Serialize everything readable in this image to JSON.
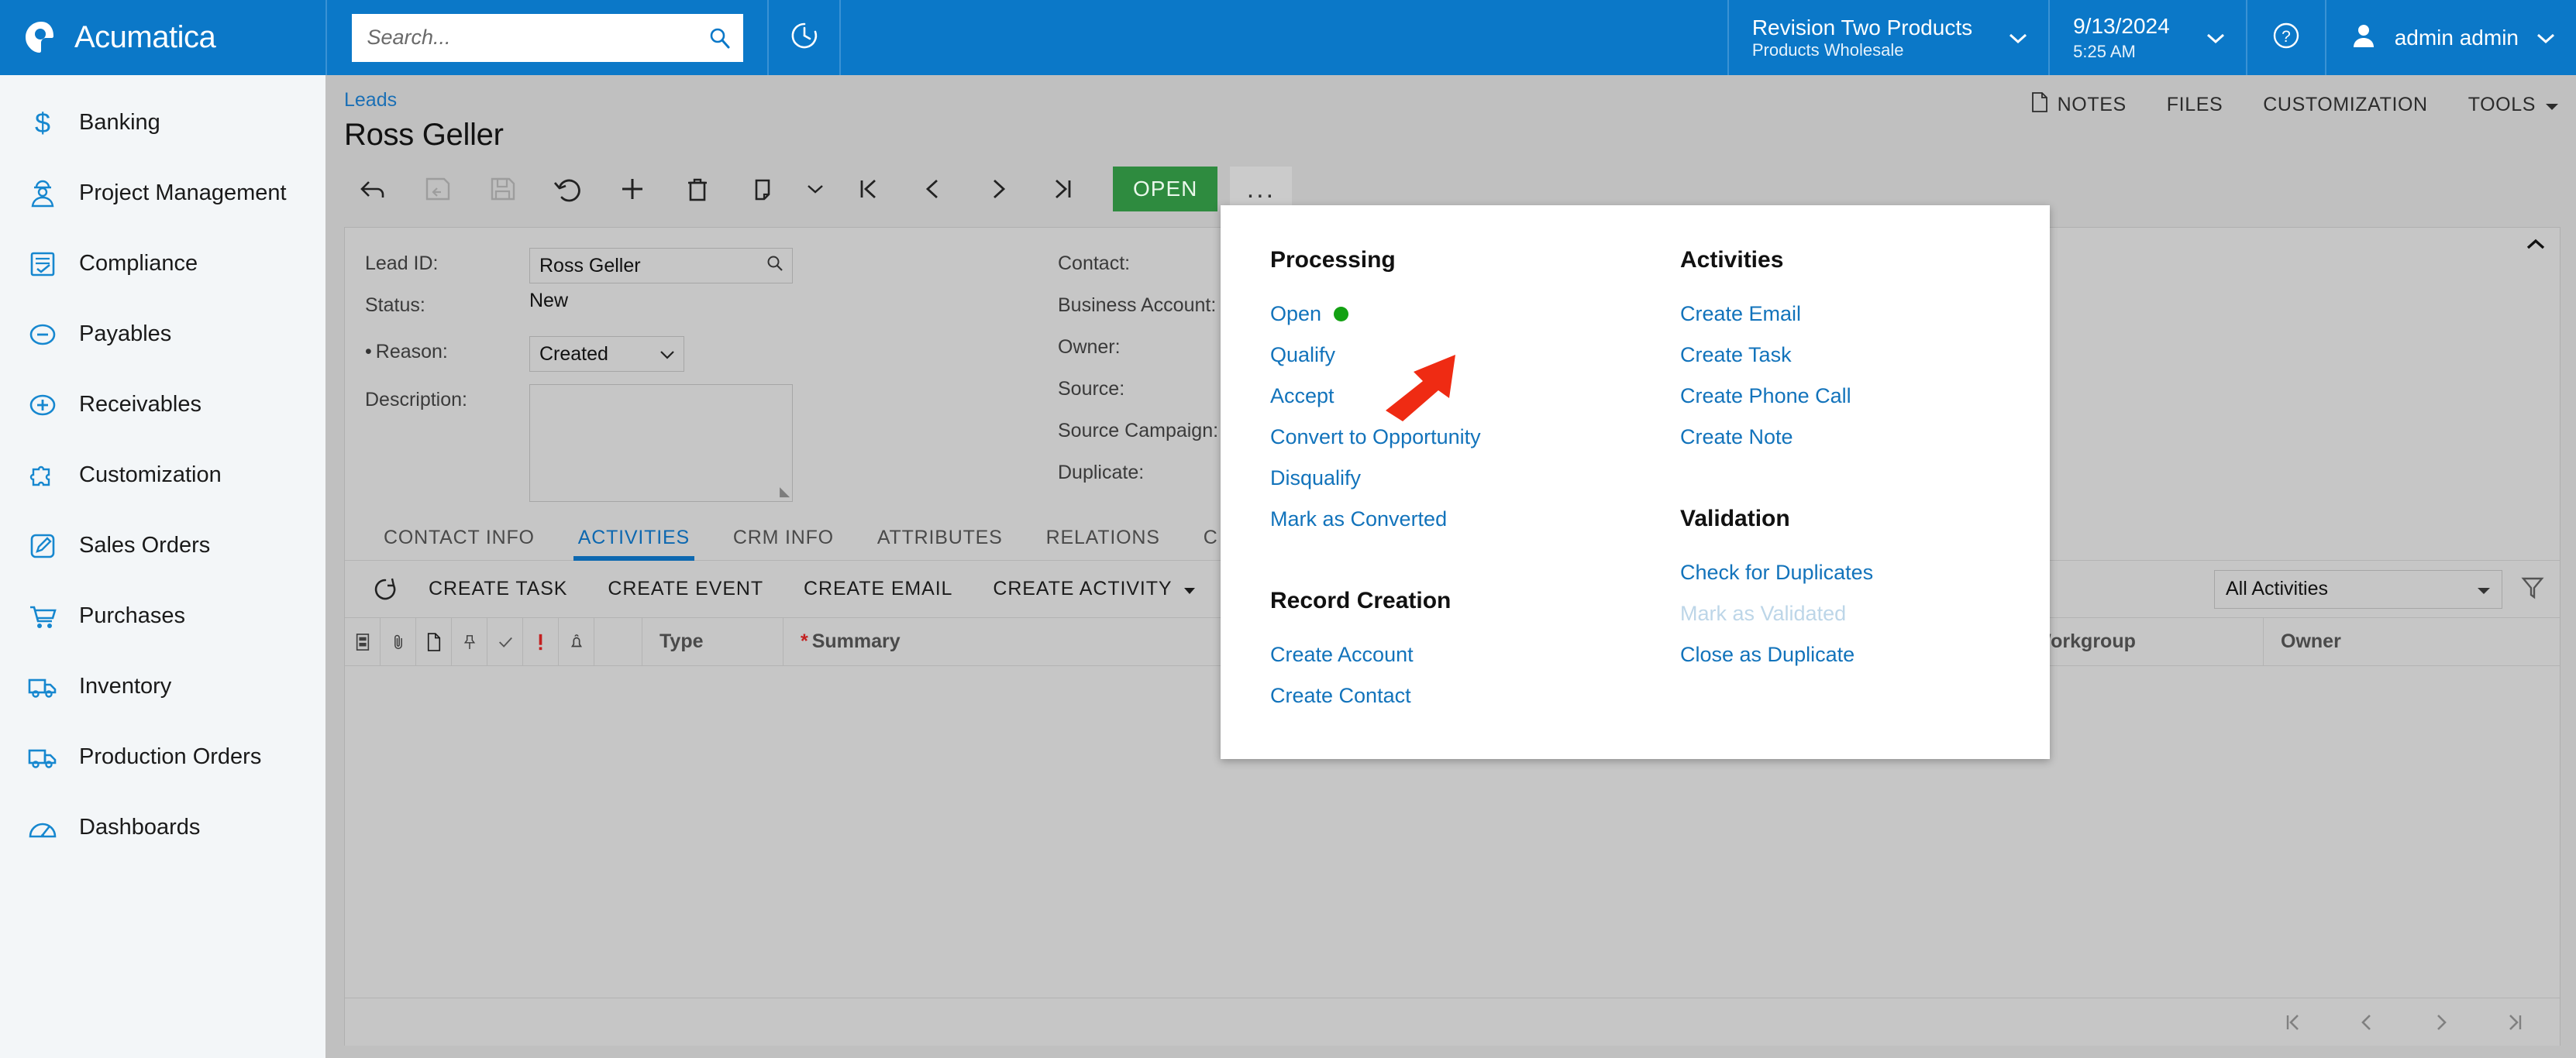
{
  "topbar": {
    "brand": "Acumatica",
    "brand_logo_icon": "acumatica-logo-icon",
    "search": {
      "placeholder": "Search...",
      "value": "",
      "icon": "search-icon"
    },
    "recent_icon": "clock-history-icon",
    "org": {
      "line1": "Revision Two Products",
      "line2": "Products Wholesale",
      "chevron": "chevron-down-icon"
    },
    "datetime": {
      "date": "9/13/2024",
      "time": "5:25 AM",
      "chevron": "chevron-down-icon"
    },
    "help_icon": "help-circle-icon",
    "user": {
      "name": "admin admin",
      "avatar_icon": "user-icon",
      "chevron": "chevron-down-icon"
    }
  },
  "sidebar": {
    "items": [
      {
        "label": "Banking",
        "icon": "dollar-icon"
      },
      {
        "label": "Project Management",
        "icon": "worker-icon"
      },
      {
        "label": "Compliance",
        "icon": "checklist-icon"
      },
      {
        "label": "Payables",
        "icon": "minus-circle-icon"
      },
      {
        "label": "Receivables",
        "icon": "plus-circle-icon"
      },
      {
        "label": "Customization",
        "icon": "puzzle-icon"
      },
      {
        "label": "Sales Orders",
        "icon": "pencil-square-icon"
      },
      {
        "label": "Purchases",
        "icon": "shopping-cart-icon"
      },
      {
        "label": "Inventory",
        "icon": "truck-icon"
      },
      {
        "label": "Production Orders",
        "icon": "truck-icon"
      },
      {
        "label": "Dashboards",
        "icon": "gauge-icon"
      }
    ]
  },
  "page": {
    "breadcrumb": "Leads",
    "title": "Ross Geller",
    "actions": [
      {
        "label": "NOTES",
        "icon": "note-page-icon"
      },
      {
        "label": "FILES",
        "icon": ""
      },
      {
        "label": "CUSTOMIZATION",
        "icon": ""
      },
      {
        "label": "TOOLS",
        "icon": "caret-down-icon"
      }
    ]
  },
  "toolbar": {
    "buttons": [
      {
        "name": "back-button",
        "icon": "arrow-back-icon",
        "enabled": true
      },
      {
        "name": "save-and-close-button",
        "icon": "save-close-icon",
        "enabled": false
      },
      {
        "name": "save-button",
        "icon": "floppy-save-icon",
        "enabled": false
      },
      {
        "name": "undo-button",
        "icon": "undo-icon",
        "enabled": true
      },
      {
        "name": "add-button",
        "icon": "plus-icon",
        "enabled": true
      },
      {
        "name": "delete-button",
        "icon": "trash-icon",
        "enabled": true
      },
      {
        "name": "copy-paste-button",
        "icon": "clipboard-icon",
        "enabled": true
      },
      {
        "name": "copy-paste-dropdown",
        "icon": "chevron-down-icon",
        "enabled": true
      },
      {
        "name": "first-record-button",
        "icon": "first-page-icon",
        "enabled": true
      },
      {
        "name": "previous-record-button",
        "icon": "chevron-left-icon",
        "enabled": true
      },
      {
        "name": "next-record-button",
        "icon": "chevron-right-icon",
        "enabled": true
      },
      {
        "name": "last-record-button",
        "icon": "last-page-icon",
        "enabled": true
      }
    ],
    "open_label": "OPEN",
    "more_label": "..."
  },
  "form": {
    "left": [
      {
        "label": "Lead ID:",
        "value": "Ross Geller",
        "type": "lookup",
        "required": false
      },
      {
        "label": "Status:",
        "value": "New",
        "type": "static",
        "required": false
      },
      {
        "label": "Reason:",
        "value": "Created",
        "type": "select",
        "required": true
      },
      {
        "label": "Description:",
        "value": "",
        "type": "textarea",
        "required": false
      }
    ],
    "right": [
      {
        "label": "Contact:",
        "value": ""
      },
      {
        "label": "Business Account:",
        "value": ""
      },
      {
        "label": "Owner:",
        "value": ""
      },
      {
        "label": "Source:",
        "value": ""
      },
      {
        "label": "Source Campaign:",
        "value": ""
      },
      {
        "label": "Duplicate:",
        "value": ""
      }
    ]
  },
  "tabs": [
    {
      "label": "CONTACT INFO",
      "active": false
    },
    {
      "label": "ACTIVITIES",
      "active": true
    },
    {
      "label": "CRM INFO",
      "active": false
    },
    {
      "label": "ATTRIBUTES",
      "active": false
    },
    {
      "label": "RELATIONS",
      "active": false
    },
    {
      "label": "C",
      "active": false
    }
  ],
  "grid_toolbar": {
    "refresh_icon": "refresh-icon",
    "buttons": [
      "CREATE TASK",
      "CREATE EVENT",
      "CREATE EMAIL",
      "CREATE ACTIVITY"
    ],
    "create_activity_caret": "caret-down-icon",
    "filter_select": "All Activities",
    "filter_icon": "funnel-icon"
  },
  "grid": {
    "icon_columns": [
      "files-icon",
      "paperclip-icon",
      "document-icon",
      "pin-icon",
      "check-icon",
      "exclamation-icon",
      "bell-icon"
    ],
    "columns": [
      "Type",
      "Summary",
      "Workgroup",
      "Owner"
    ],
    "summary_required": true,
    "rows": [],
    "pagination": [
      "first-page-icon",
      "chevron-left-icon",
      "chevron-right-icon",
      "last-page-icon"
    ]
  },
  "menu": {
    "groups": [
      {
        "title": "Processing",
        "items": [
          {
            "label": "Open",
            "badge": "green-dot",
            "disabled": false
          },
          {
            "label": "Qualify",
            "disabled": false
          },
          {
            "label": "Accept",
            "disabled": false
          },
          {
            "label": "Convert to Opportunity",
            "disabled": false
          },
          {
            "label": "Disqualify",
            "disabled": false
          },
          {
            "label": "Mark as Converted",
            "disabled": false
          }
        ]
      },
      {
        "title": "Record Creation",
        "items": [
          {
            "label": "Create Account",
            "disabled": false
          },
          {
            "label": "Create Contact",
            "disabled": false
          }
        ]
      },
      {
        "title": "Activities",
        "items": [
          {
            "label": "Create Email",
            "disabled": false
          },
          {
            "label": "Create Task",
            "disabled": false
          },
          {
            "label": "Create Phone Call",
            "disabled": false
          },
          {
            "label": "Create Note",
            "disabled": false
          }
        ]
      },
      {
        "title": "Validation",
        "items": [
          {
            "label": "Check for Duplicates",
            "disabled": false
          },
          {
            "label": "Mark as Validated",
            "disabled": true
          },
          {
            "label": "Close as Duplicate",
            "disabled": false
          }
        ]
      }
    ]
  },
  "annotation": {
    "type": "red-arrow",
    "points_to": "Convert to Opportunity",
    "color": "#ef2b13"
  },
  "colors": {
    "brand_blue": "#0b78c8",
    "link_blue": "#1273bb",
    "open_green": "#2e8b3f",
    "status_dot_green": "#13a113",
    "chrome_gray": "#c0c0c0",
    "sidebar_bg": "#f3f6f8",
    "annotation_red": "#ef2b13"
  }
}
